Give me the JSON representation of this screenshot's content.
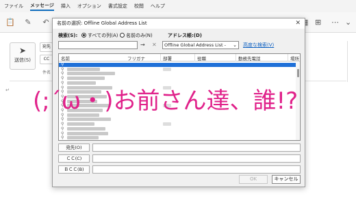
{
  "menubar": {
    "items": [
      "ファイル",
      "メッセージ",
      "挿入",
      "オプション",
      "書式設定",
      "校閲",
      "ヘルプ"
    ],
    "active_index": 1
  },
  "compose": {
    "send_label": "送信(S)",
    "to_label": "宛先",
    "cc_label": "CC",
    "subject_label": "件名"
  },
  "dialog": {
    "title": "名前の選択: Offline Global Address List",
    "search_label": "検索(S):",
    "radio_all_columns": "すべての列(A)",
    "radio_name_only": "名前のみ(N)",
    "address_book_label": "アドレス帳:(D)",
    "address_book_value": "Offline Global Address List -",
    "advanced_search": "高度な検索(V)",
    "columns": [
      "名前",
      "フリガナ",
      "部署",
      "役職",
      "勤務先電話",
      "場所"
    ],
    "recipients": {
      "to": "宛先(O)",
      "cc": "ＣＣ(C)",
      "bcc": "ＢＣＣ(B)"
    },
    "ok": "OK",
    "cancel": "キャンセル"
  },
  "overlay": {
    "text": "(;´ω・)お前さん達、誰!?",
    "color": "#e0218a"
  },
  "colors": {
    "selection": "#1f70d8",
    "link": "#0b5fc1"
  }
}
